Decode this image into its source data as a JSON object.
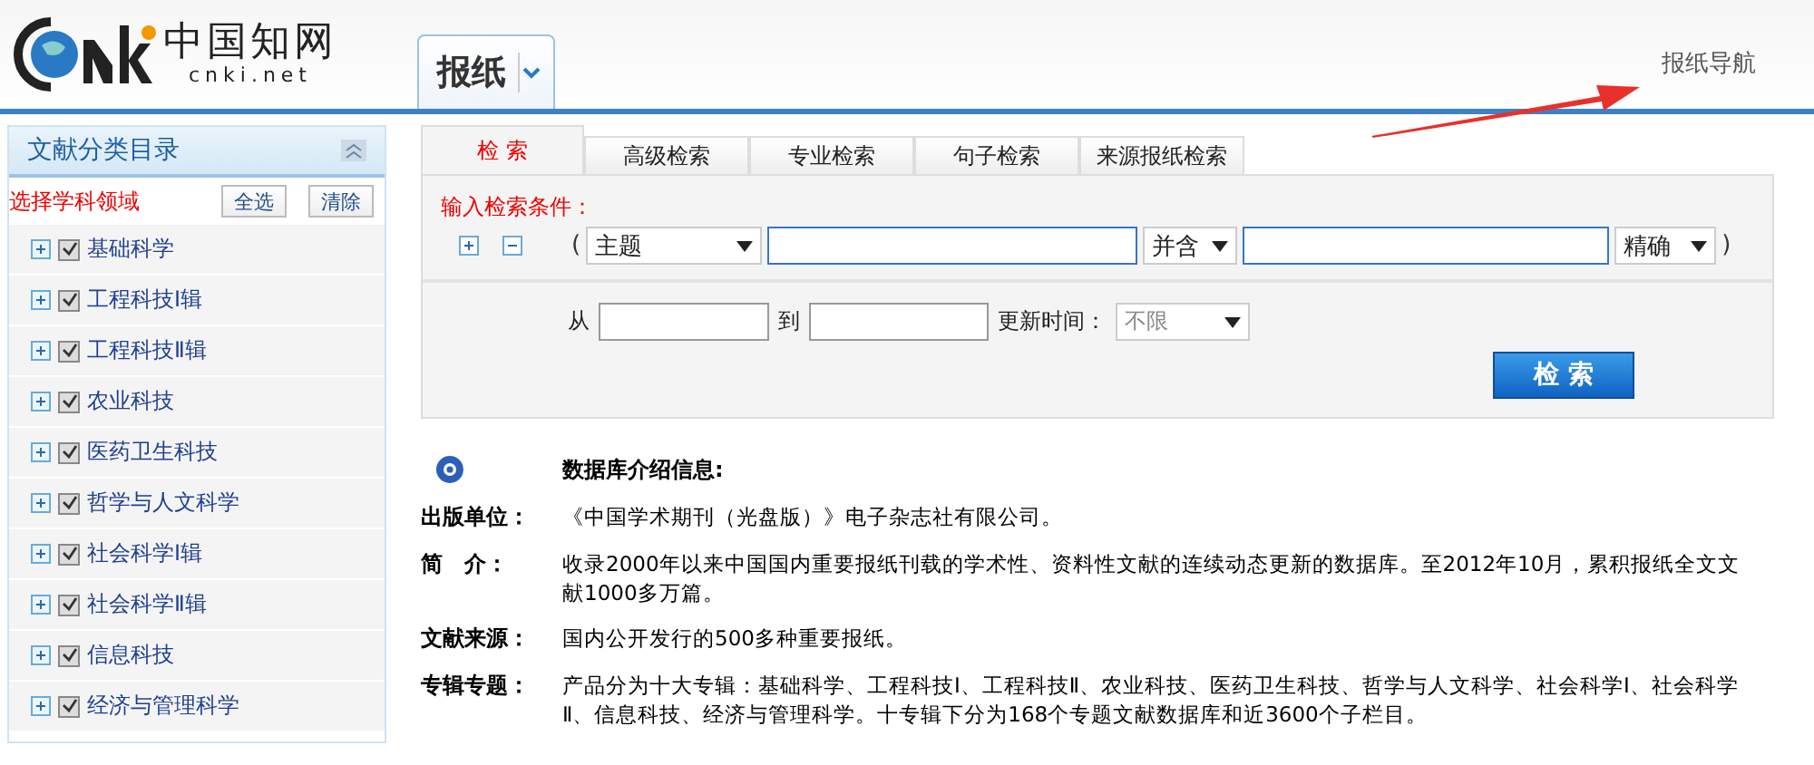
{
  "header": {
    "logo_text": "cnki.net",
    "logo_cn": "中国知网",
    "database": "报纸",
    "nav_link": "报纸导航"
  },
  "sidebar": {
    "title": "文献分类目录",
    "choose_label": "选择学科领域",
    "buttons": [
      "全选",
      "清除"
    ],
    "items": [
      {
        "label": "基础科学",
        "checked": true
      },
      {
        "label": "工程科技Ⅰ辑",
        "checked": true
      },
      {
        "label": "工程科技Ⅱ辑",
        "checked": true
      },
      {
        "label": "农业科技",
        "checked": true
      },
      {
        "label": "医药卫生科技",
        "checked": true
      },
      {
        "label": "哲学与人文科学",
        "checked": true
      },
      {
        "label": "社会科学Ⅰ辑",
        "checked": true
      },
      {
        "label": "社会科学Ⅱ辑",
        "checked": true
      },
      {
        "label": "信息科技",
        "checked": true
      },
      {
        "label": "经济与管理科学",
        "checked": true
      }
    ]
  },
  "tabs": [
    {
      "label": "检 索",
      "selected": true
    },
    {
      "label": "高级检索",
      "selected": false
    },
    {
      "label": "专业检索",
      "selected": false
    },
    {
      "label": "句子检索",
      "selected": false
    },
    {
      "label": "来源报纸检索",
      "selected": false
    }
  ],
  "search": {
    "condition_label": "输入检索条件：",
    "open_paren": "(",
    "field": "主题",
    "logic": "并含",
    "match": "精确",
    "close_paren": ")",
    "from_label": "从",
    "to_label": "到",
    "update_label": "更新时间：",
    "update_value": "不限",
    "submit": "检 索"
  },
  "info": {
    "title": "数据库介绍信息:",
    "rows": [
      {
        "label": "出版单位：",
        "text": "《中国学术期刊（光盘版）》电子杂志社有限公司。"
      },
      {
        "label": "简　介：",
        "text": "收录2000年以来中国国内重要报纸刊载的学术性、资料性文献的连续动态更新的数据库。至2012年10月，累积报纸全文文献1000多万篇。"
      },
      {
        "label": "文献来源：",
        "text": "国内公开发行的500多种重要报纸。"
      },
      {
        "label": "专辑专题：",
        "text": "产品分为十大专辑：基础科学、工程科技Ⅰ、工程科技Ⅱ、农业科技、医药卫生科技、哲学与人文科学、社会科学Ⅰ、社会科学Ⅱ、信息科技、经济与管理科学。十专辑下分为168个专题文献数据库和近3600个子栏目。"
      }
    ]
  }
}
